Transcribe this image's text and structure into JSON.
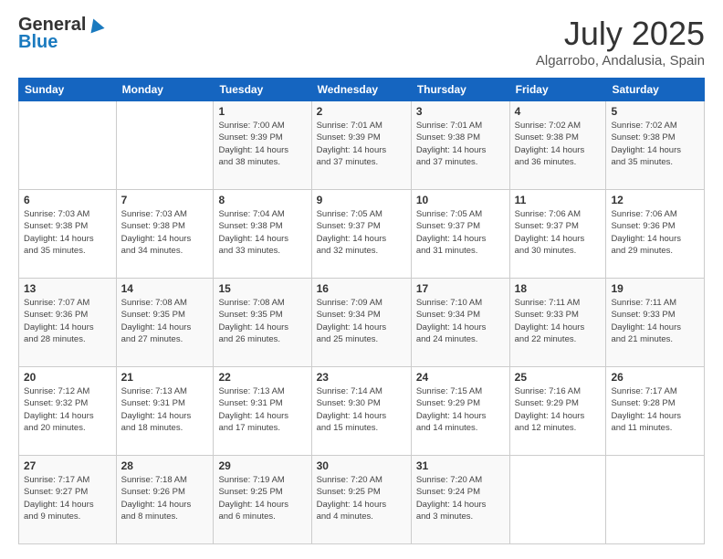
{
  "header": {
    "logo_general": "General",
    "logo_blue": "Blue",
    "month": "July 2025",
    "location": "Algarrobo, Andalusia, Spain"
  },
  "weekdays": [
    "Sunday",
    "Monday",
    "Tuesday",
    "Wednesday",
    "Thursday",
    "Friday",
    "Saturday"
  ],
  "weeks": [
    [
      {
        "day": "",
        "sunrise": "",
        "sunset": "",
        "daylight": ""
      },
      {
        "day": "",
        "sunrise": "",
        "sunset": "",
        "daylight": ""
      },
      {
        "day": "1",
        "sunrise": "Sunrise: 7:00 AM",
        "sunset": "Sunset: 9:39 PM",
        "daylight": "Daylight: 14 hours and 38 minutes."
      },
      {
        "day": "2",
        "sunrise": "Sunrise: 7:01 AM",
        "sunset": "Sunset: 9:39 PM",
        "daylight": "Daylight: 14 hours and 37 minutes."
      },
      {
        "day": "3",
        "sunrise": "Sunrise: 7:01 AM",
        "sunset": "Sunset: 9:38 PM",
        "daylight": "Daylight: 14 hours and 37 minutes."
      },
      {
        "day": "4",
        "sunrise": "Sunrise: 7:02 AM",
        "sunset": "Sunset: 9:38 PM",
        "daylight": "Daylight: 14 hours and 36 minutes."
      },
      {
        "day": "5",
        "sunrise": "Sunrise: 7:02 AM",
        "sunset": "Sunset: 9:38 PM",
        "daylight": "Daylight: 14 hours and 35 minutes."
      }
    ],
    [
      {
        "day": "6",
        "sunrise": "Sunrise: 7:03 AM",
        "sunset": "Sunset: 9:38 PM",
        "daylight": "Daylight: 14 hours and 35 minutes."
      },
      {
        "day": "7",
        "sunrise": "Sunrise: 7:03 AM",
        "sunset": "Sunset: 9:38 PM",
        "daylight": "Daylight: 14 hours and 34 minutes."
      },
      {
        "day": "8",
        "sunrise": "Sunrise: 7:04 AM",
        "sunset": "Sunset: 9:38 PM",
        "daylight": "Daylight: 14 hours and 33 minutes."
      },
      {
        "day": "9",
        "sunrise": "Sunrise: 7:05 AM",
        "sunset": "Sunset: 9:37 PM",
        "daylight": "Daylight: 14 hours and 32 minutes."
      },
      {
        "day": "10",
        "sunrise": "Sunrise: 7:05 AM",
        "sunset": "Sunset: 9:37 PM",
        "daylight": "Daylight: 14 hours and 31 minutes."
      },
      {
        "day": "11",
        "sunrise": "Sunrise: 7:06 AM",
        "sunset": "Sunset: 9:37 PM",
        "daylight": "Daylight: 14 hours and 30 minutes."
      },
      {
        "day": "12",
        "sunrise": "Sunrise: 7:06 AM",
        "sunset": "Sunset: 9:36 PM",
        "daylight": "Daylight: 14 hours and 29 minutes."
      }
    ],
    [
      {
        "day": "13",
        "sunrise": "Sunrise: 7:07 AM",
        "sunset": "Sunset: 9:36 PM",
        "daylight": "Daylight: 14 hours and 28 minutes."
      },
      {
        "day": "14",
        "sunrise": "Sunrise: 7:08 AM",
        "sunset": "Sunset: 9:35 PM",
        "daylight": "Daylight: 14 hours and 27 minutes."
      },
      {
        "day": "15",
        "sunrise": "Sunrise: 7:08 AM",
        "sunset": "Sunset: 9:35 PM",
        "daylight": "Daylight: 14 hours and 26 minutes."
      },
      {
        "day": "16",
        "sunrise": "Sunrise: 7:09 AM",
        "sunset": "Sunset: 9:34 PM",
        "daylight": "Daylight: 14 hours and 25 minutes."
      },
      {
        "day": "17",
        "sunrise": "Sunrise: 7:10 AM",
        "sunset": "Sunset: 9:34 PM",
        "daylight": "Daylight: 14 hours and 24 minutes."
      },
      {
        "day": "18",
        "sunrise": "Sunrise: 7:11 AM",
        "sunset": "Sunset: 9:33 PM",
        "daylight": "Daylight: 14 hours and 22 minutes."
      },
      {
        "day": "19",
        "sunrise": "Sunrise: 7:11 AM",
        "sunset": "Sunset: 9:33 PM",
        "daylight": "Daylight: 14 hours and 21 minutes."
      }
    ],
    [
      {
        "day": "20",
        "sunrise": "Sunrise: 7:12 AM",
        "sunset": "Sunset: 9:32 PM",
        "daylight": "Daylight: 14 hours and 20 minutes."
      },
      {
        "day": "21",
        "sunrise": "Sunrise: 7:13 AM",
        "sunset": "Sunset: 9:31 PM",
        "daylight": "Daylight: 14 hours and 18 minutes."
      },
      {
        "day": "22",
        "sunrise": "Sunrise: 7:13 AM",
        "sunset": "Sunset: 9:31 PM",
        "daylight": "Daylight: 14 hours and 17 minutes."
      },
      {
        "day": "23",
        "sunrise": "Sunrise: 7:14 AM",
        "sunset": "Sunset: 9:30 PM",
        "daylight": "Daylight: 14 hours and 15 minutes."
      },
      {
        "day": "24",
        "sunrise": "Sunrise: 7:15 AM",
        "sunset": "Sunset: 9:29 PM",
        "daylight": "Daylight: 14 hours and 14 minutes."
      },
      {
        "day": "25",
        "sunrise": "Sunrise: 7:16 AM",
        "sunset": "Sunset: 9:29 PM",
        "daylight": "Daylight: 14 hours and 12 minutes."
      },
      {
        "day": "26",
        "sunrise": "Sunrise: 7:17 AM",
        "sunset": "Sunset: 9:28 PM",
        "daylight": "Daylight: 14 hours and 11 minutes."
      }
    ],
    [
      {
        "day": "27",
        "sunrise": "Sunrise: 7:17 AM",
        "sunset": "Sunset: 9:27 PM",
        "daylight": "Daylight: 14 hours and 9 minutes."
      },
      {
        "day": "28",
        "sunrise": "Sunrise: 7:18 AM",
        "sunset": "Sunset: 9:26 PM",
        "daylight": "Daylight: 14 hours and 8 minutes."
      },
      {
        "day": "29",
        "sunrise": "Sunrise: 7:19 AM",
        "sunset": "Sunset: 9:25 PM",
        "daylight": "Daylight: 14 hours and 6 minutes."
      },
      {
        "day": "30",
        "sunrise": "Sunrise: 7:20 AM",
        "sunset": "Sunset: 9:25 PM",
        "daylight": "Daylight: 14 hours and 4 minutes."
      },
      {
        "day": "31",
        "sunrise": "Sunrise: 7:20 AM",
        "sunset": "Sunset: 9:24 PM",
        "daylight": "Daylight: 14 hours and 3 minutes."
      },
      {
        "day": "",
        "sunrise": "",
        "sunset": "",
        "daylight": ""
      },
      {
        "day": "",
        "sunrise": "",
        "sunset": "",
        "daylight": ""
      }
    ]
  ]
}
